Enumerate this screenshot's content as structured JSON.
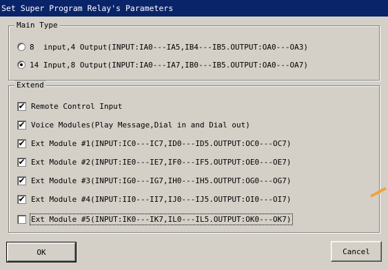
{
  "window": {
    "title": "Set Super Program Relay's Parameters"
  },
  "main_type": {
    "legend": "Main Type",
    "options": [
      {
        "label": "8  input,4 Output(INPUT:IA0---IA5,IB4---IB5.OUTPUT:OA0---OA3)",
        "selected": false
      },
      {
        "label": "14 Input,8 Output(INPUT:IA0---IA7,IB0---IB5.OUTPUT:OA0---OA7)",
        "selected": true
      }
    ]
  },
  "extend": {
    "legend": "Extend",
    "items": [
      {
        "label": "Remote Control Input",
        "checked": true,
        "mark": "✔"
      },
      {
        "label": "Voice Modules(Play Message,Dial in and Dial out)",
        "checked": true,
        "mark": "✔"
      },
      {
        "label": "Ext Module #1(INPUT:IC0---IC7,ID0---ID5.OUTPUT:OC0---OC7)",
        "checked": true,
        "mark": "✔"
      },
      {
        "label": "Ext Module #2(INPUT:IE0---IE7,IF0---IF5.OUTPUT:OE0---OE7)",
        "checked": true,
        "mark": "✔"
      },
      {
        "label": "Ext Module #3(INPUT:IG0---IG7,IH0---IH5.OUTPUT:OG0---OG7)",
        "checked": true,
        "mark": "✔"
      },
      {
        "label": "Ext Module #4(INPUT:II0---II7,IJ0---IJ5.OUTPUT:OI0---OI7)",
        "checked": true,
        "mark": "✔"
      },
      {
        "label": "Ext Module #5(INPUT:IK0---IK7,IL0---IL5.OUTPUT:OK0---OK7)",
        "checked": false,
        "mark": ""
      }
    ]
  },
  "buttons": {
    "ok": "OK",
    "cancel": "Cancel"
  },
  "colors": {
    "titlebar": "#0a246a",
    "face": "#d4d0c8",
    "annotation_arrow": "#f2a33a"
  }
}
